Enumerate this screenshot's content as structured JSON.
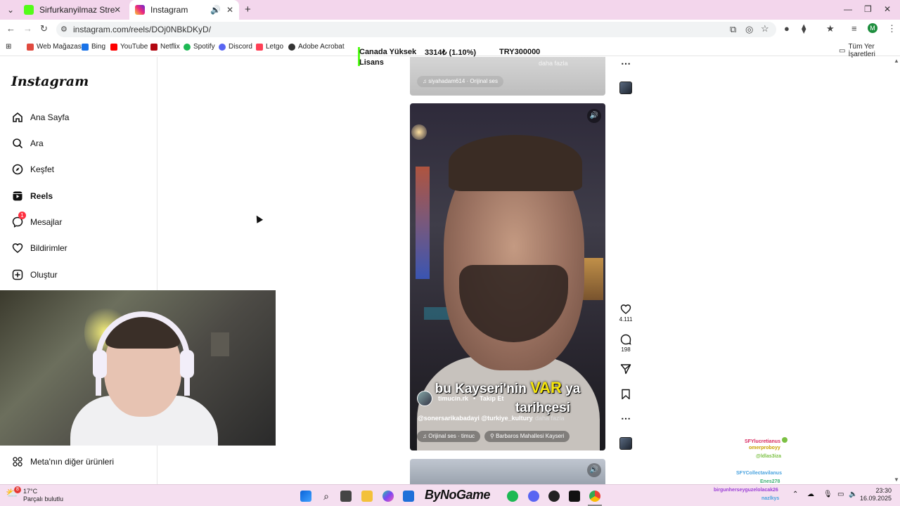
{
  "browser": {
    "tabs": [
      {
        "title": "Sirfurkanyilmaz Stream - Watch",
        "fav_color": "#53fc18"
      },
      {
        "title": "Instagram",
        "fav_color": "#d62976"
      }
    ],
    "url": "instagram.com/reels/DOj0NBkDKyD/",
    "bookmarks": [
      "Web Mağazası",
      "Bing",
      "YouTube",
      "Netflix",
      "Spotify",
      "Discord",
      "Letgo",
      "Adobe Acrobat"
    ],
    "bookmarks_all": "Tüm Yer İşaretleri"
  },
  "ticker": {
    "line1": "Canada Yüksek",
    "line2": "Lisans",
    "amount": "3314₺ (1.10%)",
    "goal": "TRY300000"
  },
  "instagram": {
    "logo": "Instagram",
    "nav": [
      {
        "label": "Ana Sayfa",
        "icon": "home-icon"
      },
      {
        "label": "Ara",
        "icon": "search-icon"
      },
      {
        "label": "Keşfet",
        "icon": "compass-icon"
      },
      {
        "label": "Reels",
        "icon": "reels-icon"
      },
      {
        "label": "Mesajlar",
        "icon": "messenger-icon"
      },
      {
        "label": "Bildirimler",
        "icon": "heart-icon"
      },
      {
        "label": "Oluştur",
        "icon": "plus-icon"
      }
    ],
    "messages_badge": "1",
    "more": "Meta'nın diğer ürünleri"
  },
  "prev_reel": {
    "more": "daha fazla",
    "audio": "siyahadam614 · Orijinal ses"
  },
  "reel": {
    "subtitle1": "bu Kayseri'nin",
    "subtitle_highlight": "VAR",
    "subtitle1_end": "ya",
    "subtitle2": "tarihçesi",
    "username": "timucin.rk",
    "follow": "Takip Et",
    "caption": "@sonersarikabadayi @turkiye_kultury",
    "caption_more": "... daha fazla",
    "audio": "Orijinal ses · timuc",
    "location": "Barbaros Mahallesi Kayseri",
    "likes": "4.111",
    "comments": "198"
  },
  "chat": [
    {
      "user": "SFYlucretianus",
      "color": "#d8285f"
    },
    {
      "user": "omerproboyy",
      "color": "#c9a000"
    },
    {
      "user": "@ldlas3iza",
      "color": "#7bc043"
    },
    {
      "user": "SFYCollectavilanus",
      "color": "#4aa3df"
    },
    {
      "user": "Enes278",
      "color": "#3bb273"
    },
    {
      "user": "birgunherseyguzelolacak26",
      "color": "#9b3fd6"
    },
    {
      "user": "nazlkys",
      "color": "#4aa3df"
    }
  ],
  "taskbar": {
    "temp": "17°C",
    "weather": "Parçalı bulutlu",
    "weather_badge": "8",
    "brand": "ByNoGame",
    "time": "23:30",
    "date": "16.09.2025"
  }
}
